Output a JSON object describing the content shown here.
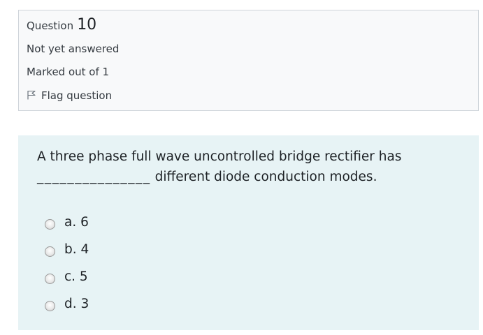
{
  "question_info": {
    "label": "Question",
    "number": "10",
    "state": "Not yet answered",
    "grade": "Marked out of 1",
    "flag_label": "Flag question"
  },
  "question": {
    "text_line1": "A three phase full wave uncontrolled bridge rectifier has",
    "blank": "_______________",
    "text_line2": " different diode conduction modes.",
    "answers": [
      {
        "label": "a. 6"
      },
      {
        "label": "b. 4"
      },
      {
        "label": "c. 5"
      },
      {
        "label": "d. 3"
      }
    ]
  },
  "icons": {
    "flag": "flag-outline-icon"
  },
  "colors": {
    "info_bg": "#f8f9fa",
    "content_bg": "#e7f3f5",
    "border": "#ced4da"
  }
}
